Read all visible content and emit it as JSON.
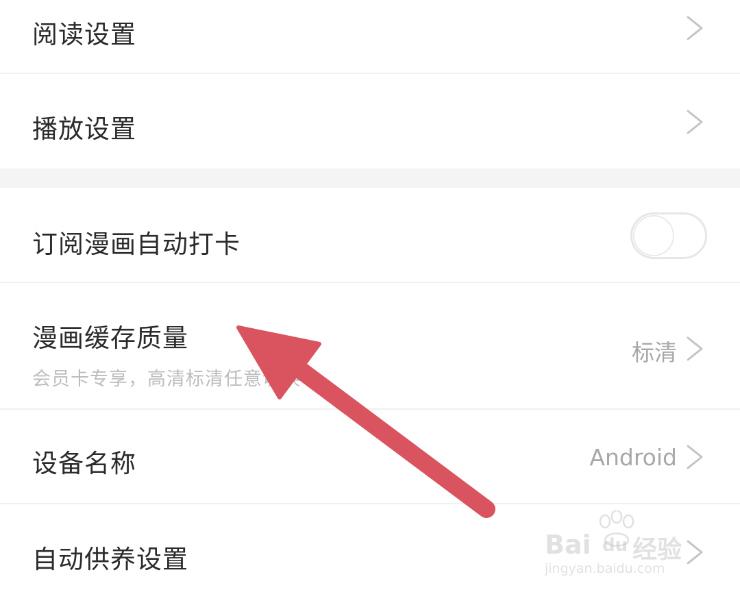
{
  "settings": {
    "items": [
      {
        "label": "阅读设置"
      },
      {
        "label": "播放设置"
      },
      {
        "label": "订阅漫画自动打卡",
        "toggle_on": false
      },
      {
        "label": "漫画缓存质量",
        "subtitle": "会员卡专享，高清标清任意切换",
        "value": "标清"
      },
      {
        "label": "设备名称",
        "value": "Android"
      },
      {
        "label": "自动供养设置"
      }
    ]
  },
  "watermark": {
    "brand_left": "Bai",
    "brand_right": "经验",
    "url": "jingyan.baidu.com"
  },
  "colors": {
    "annotation_arrow": "#d9545f",
    "text_primary": "#2b2b2b",
    "text_secondary": "#a8a8a8",
    "section_gap": "#f4f4f4"
  }
}
